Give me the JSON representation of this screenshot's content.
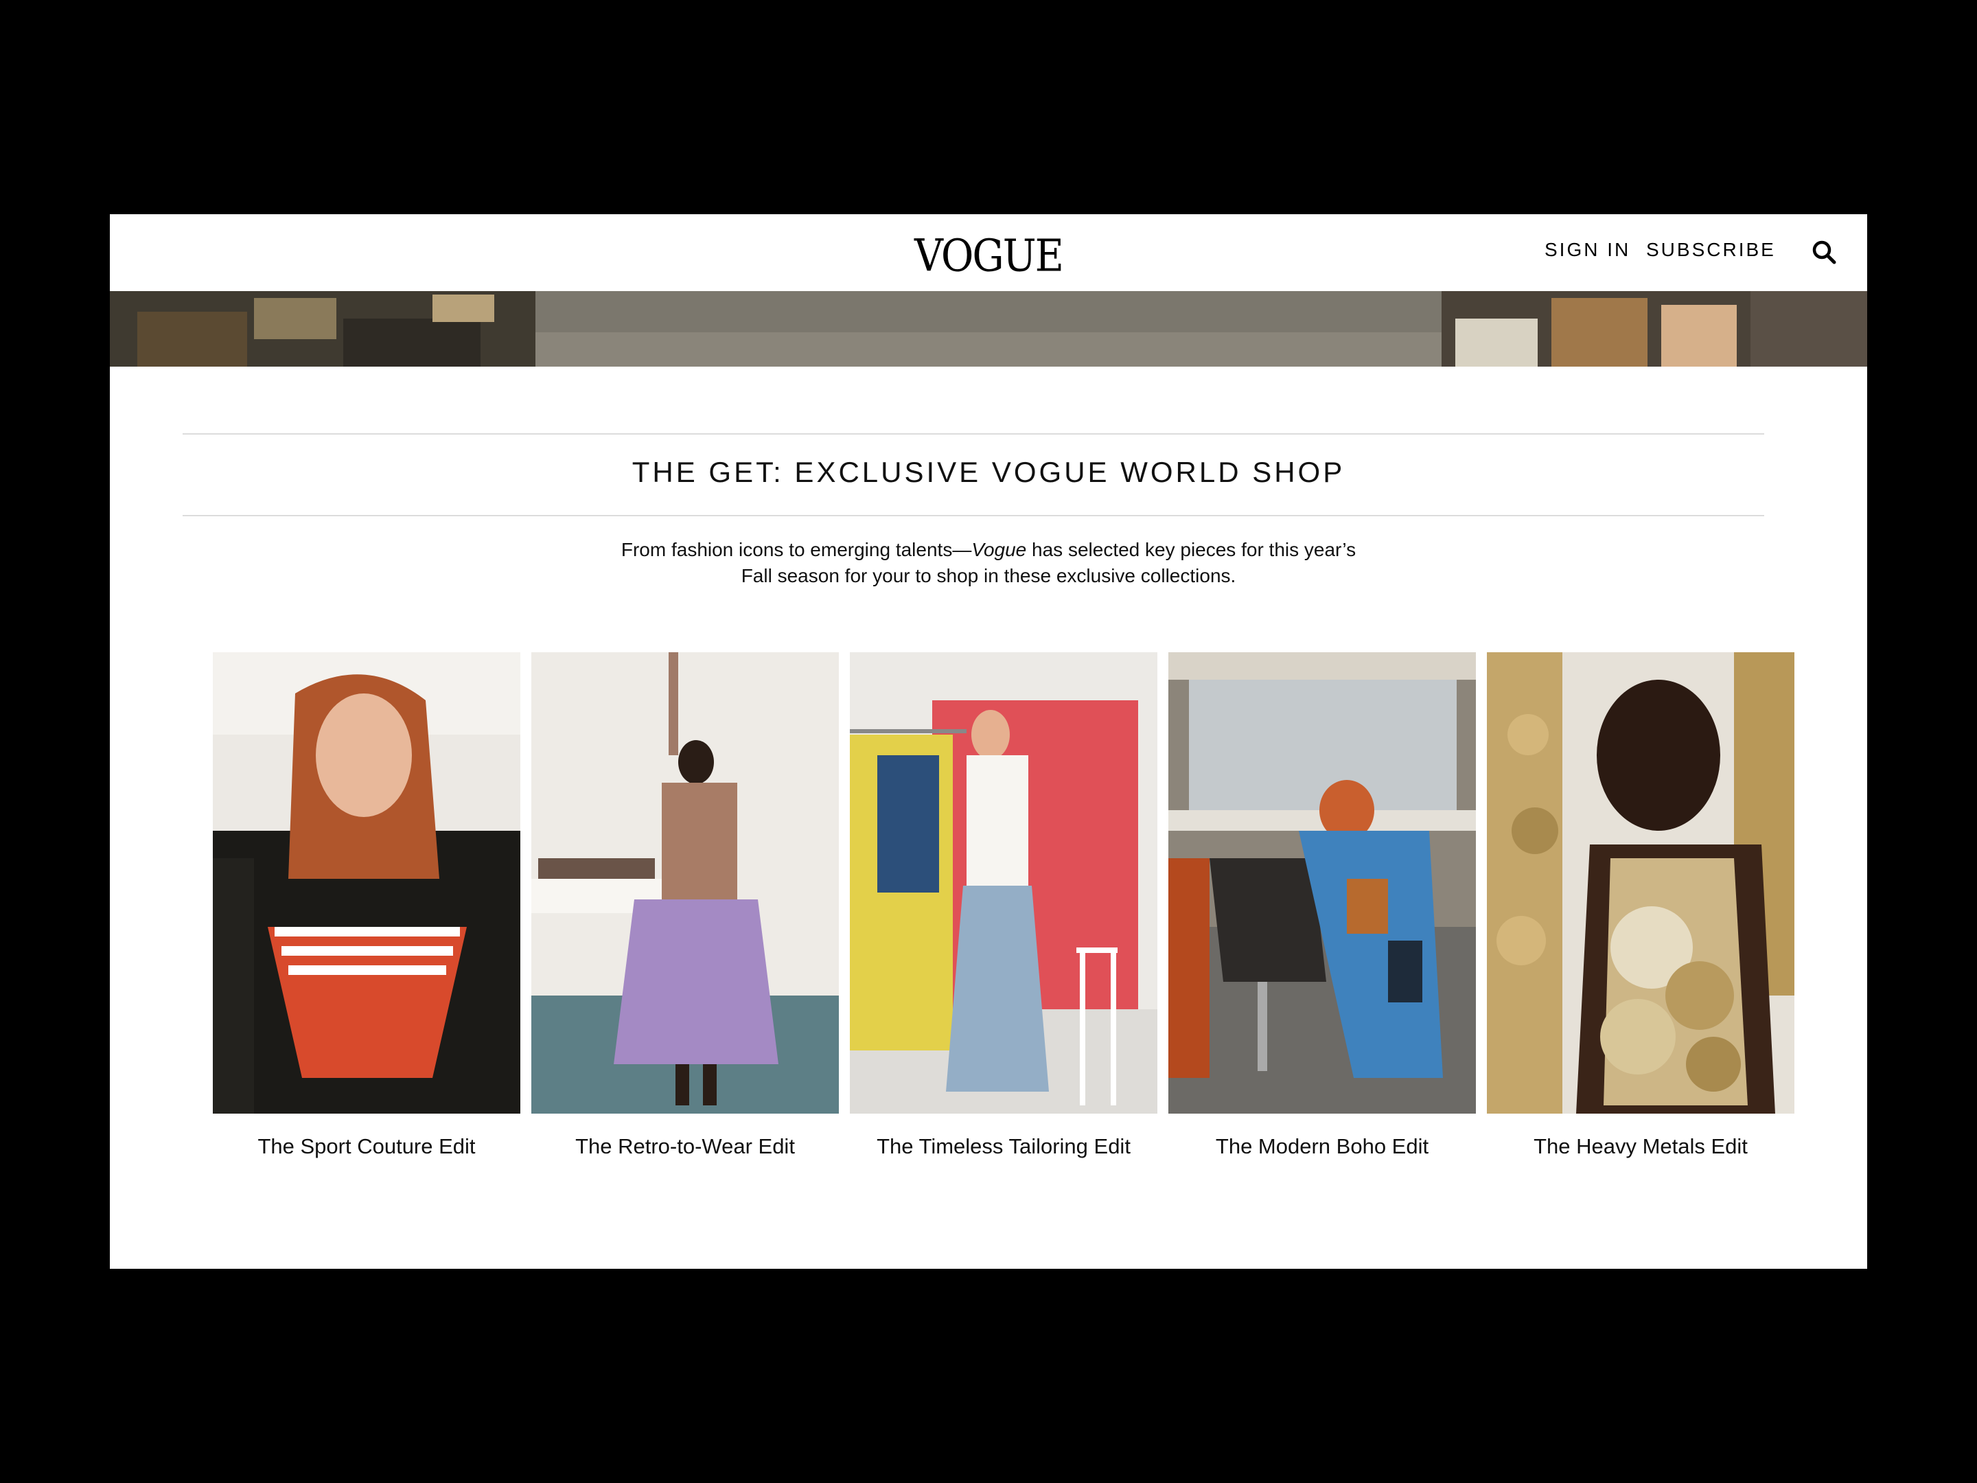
{
  "header": {
    "logo": "VOGUE",
    "sign_in": "SIGN IN",
    "subscribe": "SUBSCRIBE",
    "search_icon": "search-icon"
  },
  "section": {
    "title": "THE GET: EXCLUSIVE VOGUE WORLD SHOP",
    "intro_before": "From fashion icons to emerging talents—",
    "intro_em": "Vogue",
    "intro_line1_after": " has selected key pieces for this year’s",
    "intro_line2": "Fall season for your to shop in these exclusive collections."
  },
  "cards": [
    {
      "caption": "The Sport Couture Edit"
    },
    {
      "caption": "The Retro-to-Wear Edit"
    },
    {
      "caption": "The Timeless Tailoring Edit"
    },
    {
      "caption": "The Modern Boho Edit"
    },
    {
      "caption": "The Heavy Metals Edit"
    }
  ],
  "colors": {
    "page_background": "#000000",
    "content_background": "#ffffff",
    "text": "#111111",
    "rule": "#dcdcdc"
  }
}
